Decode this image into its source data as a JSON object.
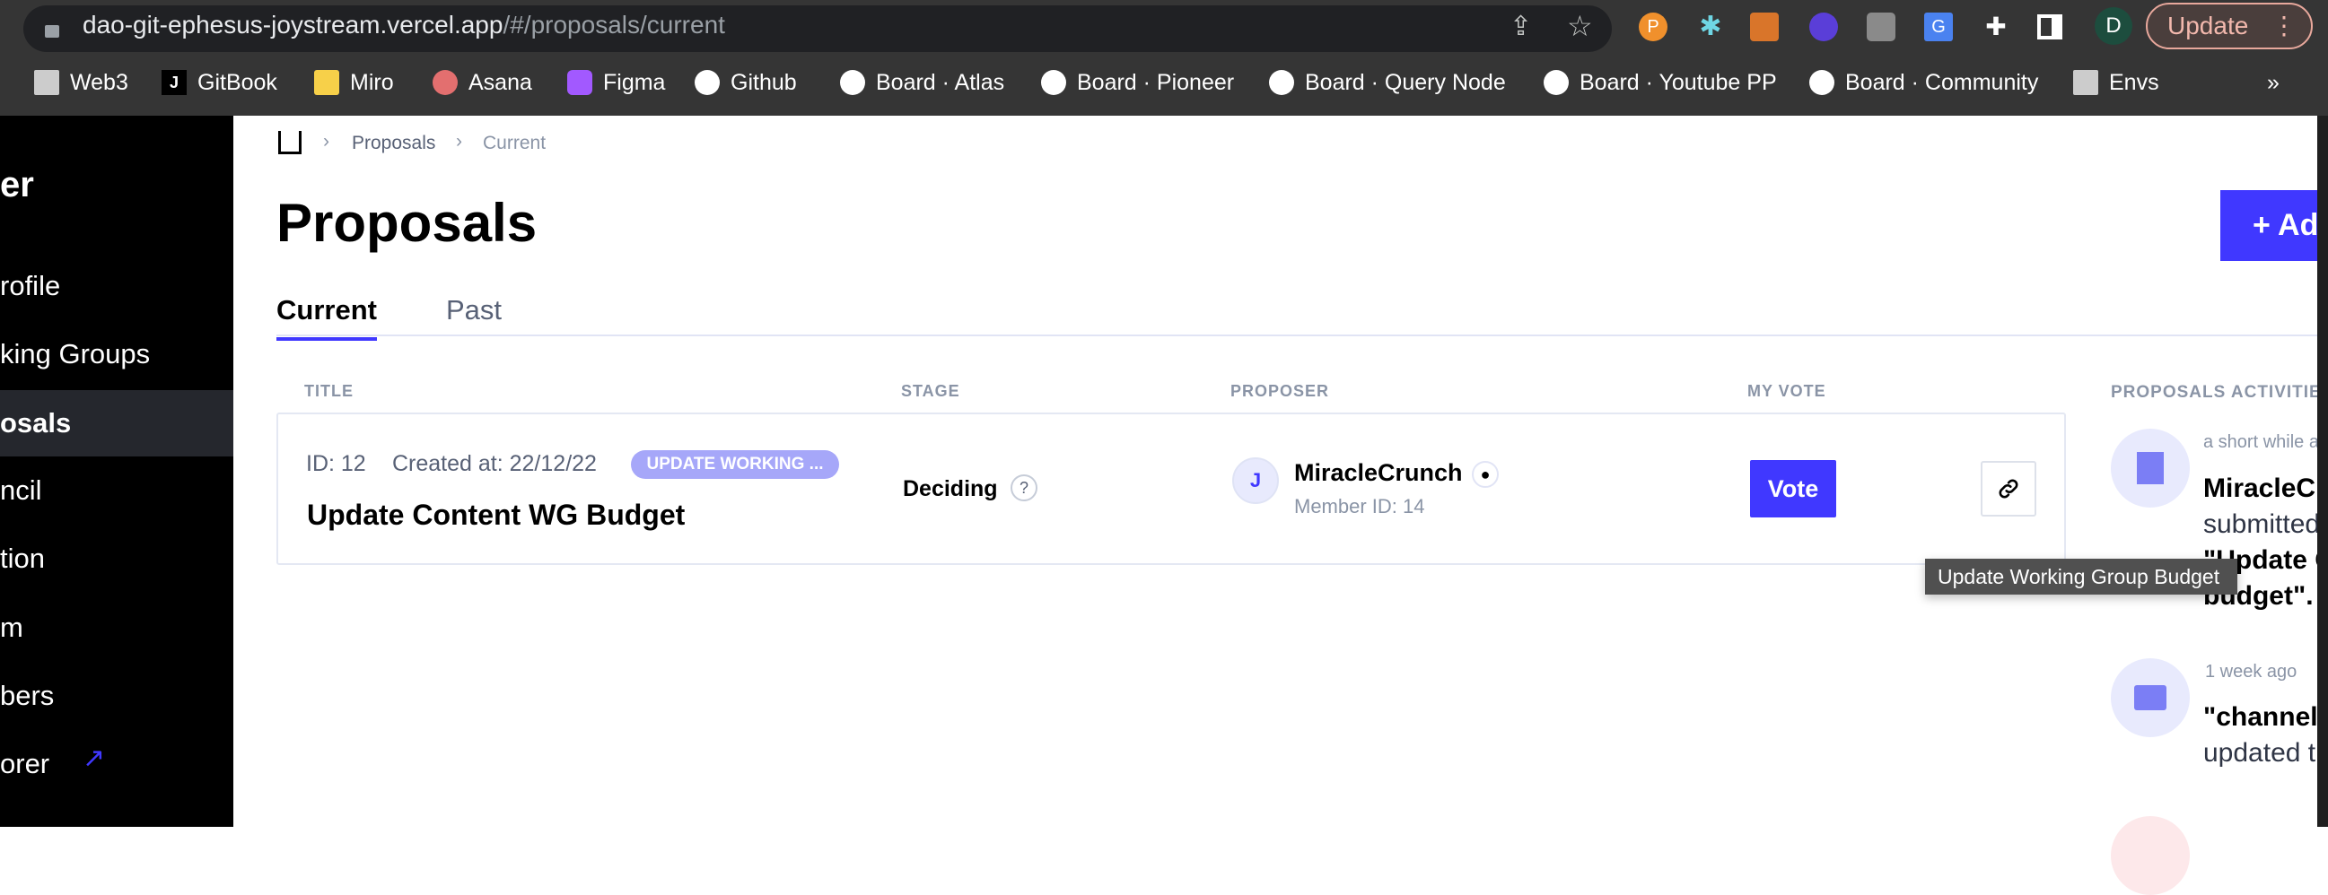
{
  "browser": {
    "url_host": "dao-git-ephesus-joystream.vercel.app",
    "url_path": "/#/proposals/current",
    "update_label": "Update",
    "profile_initial": "D",
    "bookmarks": [
      "Web3",
      "GitBook",
      "Miro",
      "Asana",
      "Figma",
      "Github",
      "Board · Atlas",
      "Board · Pioneer",
      "Board · Query Node",
      "Board · Youtube PP",
      "Board · Community",
      "Envs"
    ],
    "more": "»"
  },
  "sidebar": {
    "brand": "er",
    "items": [
      {
        "label": "rofile"
      },
      {
        "label": "king Groups"
      },
      {
        "label": "osals",
        "active": true
      },
      {
        "label": "ncil"
      },
      {
        "label": "tion"
      },
      {
        "label": "m"
      },
      {
        "label": "bers"
      },
      {
        "label": "orer",
        "external": true
      }
    ]
  },
  "breadcrumb": [
    "Proposals",
    "Current"
  ],
  "page": {
    "title": "Proposals",
    "add_button": "Ad"
  },
  "tabs": [
    {
      "label": "Current",
      "active": true
    },
    {
      "label": "Past"
    }
  ],
  "table": {
    "headers": [
      "TITLE",
      "STAGE",
      "PROPOSER",
      "MY VOTE"
    ],
    "rows": [
      {
        "id": "ID: 12",
        "created": "Created at: 22/12/22",
        "badge": "UPDATE WORKING ...",
        "title": "Update Content WG Budget",
        "stage": "Deciding",
        "proposer": "MiracleCrunch",
        "member_id": "Member ID: 14",
        "vote_label": "Vote",
        "tooltip": "Update Working Group Budget"
      }
    ]
  },
  "activities": {
    "header": "PROPOSALS ACTIVITIES",
    "items": [
      {
        "time": "a short while a",
        "name": "MiracleCr",
        "line2": "submitted",
        "line3": "\"Update C",
        "line4": "budget\"."
      },
      {
        "time": "1 week ago",
        "line1": "\"channel-",
        "line2": "updated t"
      }
    ]
  },
  "colors": {
    "accent": "#4038ff",
    "badge": "#a6a7f9",
    "sidebar": "#000000"
  }
}
